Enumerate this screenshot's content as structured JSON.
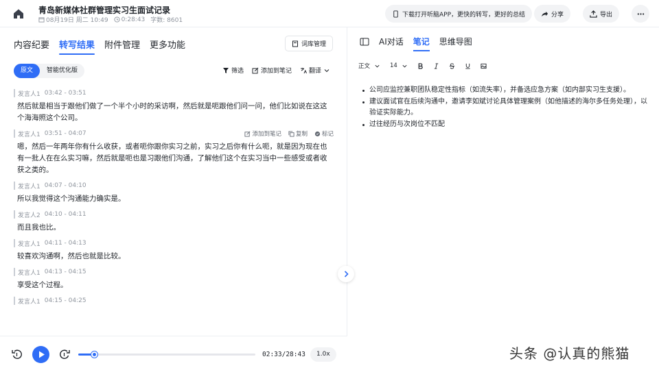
{
  "header": {
    "title": "青岛新媒体社群管理实习生面试记录",
    "date": "08月19日 周二 10:49",
    "duration": "0:28:43",
    "word_count": "字数: 8601",
    "download_banner": "下载打开听脑APP，更快的转写，更好的总结",
    "share_label": "分享",
    "export_label": "导出"
  },
  "left": {
    "tabs": [
      "内容纪要",
      "转写结果",
      "附件管理",
      "更多功能"
    ],
    "active_tab": 1,
    "lexicon_label": "词库管理",
    "view_options": [
      "原文",
      "智能优化版"
    ],
    "tools": {
      "filter": "筛选",
      "add_note": "添加到笔记",
      "translate": "翻译"
    },
    "segment_actions": {
      "add_note": "添加到笔记",
      "copy": "复制",
      "mark": "标记"
    },
    "segments": [
      {
        "speaker": "发言人1",
        "time": "03:42 - 03:51",
        "text": "然后就是相当于跟他们做了一个半个小时的采访啊，然后就是呃跟他们问一问，他们比如说在这这个海海照这个公司。"
      },
      {
        "speaker": "发言人1",
        "time": "03:51 - 04:07",
        "text": "嗯，然后一年两年你有什么收获，或者呃你跟你实习之前，实习之后你有什么呃，就是因为现在也有一批人在在么实习嘛，然后就是呃也是习跟他们沟通，了解他们这个在实习当中一些感受或者收获之类的。"
      },
      {
        "speaker": "发言人1",
        "time": "04:07 - 04:10",
        "text": "所以我觉得这个沟通能力确实是。"
      },
      {
        "speaker": "发言人2",
        "time": "04:10 - 04:11",
        "text": "而且我也比。"
      },
      {
        "speaker": "发言人1",
        "time": "04:11 - 04:13",
        "text": "较喜欢沟通啊，然后也就是比较。"
      },
      {
        "speaker": "发言人1",
        "time": "04:13 - 04:15",
        "text": "享受这个过程。"
      },
      {
        "speaker": "发言人1",
        "time": "04:15 - 04:25",
        "text": ""
      }
    ]
  },
  "player": {
    "time": "02:33/28:43",
    "speed": "1.0x",
    "progress": 0.089
  },
  "right": {
    "tabs": [
      "AI对话",
      "笔记",
      "思维导图"
    ],
    "active_tab": 1,
    "format": {
      "style": "正文",
      "size": "14"
    },
    "notes": [
      "公司应监控兼职团队稳定性指标（如流失率），并备选应急方案（如内部实习生支援）。",
      "建议面试官在后续沟通中，邀请李如斌讨论具体管理案例（如他描述的海尔多任务处理），以验证实际能力。",
      "过往经历与次岗位不匹配"
    ]
  },
  "watermark": "头条 @认真的熊猫",
  "colors": {
    "accent": "#2f6df6",
    "muted": "#8f959e"
  }
}
